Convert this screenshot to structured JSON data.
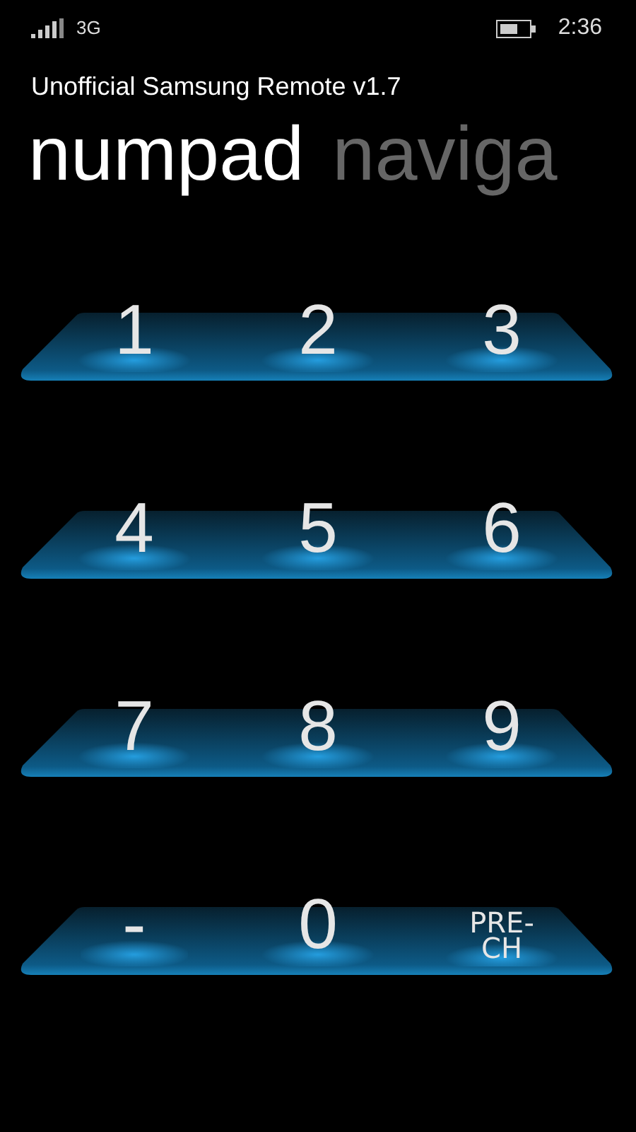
{
  "status_bar": {
    "network": "3G",
    "time": "2:36"
  },
  "app_title": "Unofficial Samsung Remote v1.7",
  "pivot": [
    {
      "label": "numpad",
      "selected": true
    },
    {
      "label": "naviga",
      "selected": false
    }
  ],
  "keypad_rows": [
    {
      "keys": [
        {
          "label": "1",
          "kind": "digit"
        },
        {
          "label": "2",
          "kind": "digit"
        },
        {
          "label": "3",
          "kind": "digit"
        }
      ]
    },
    {
      "keys": [
        {
          "label": "4",
          "kind": "digit"
        },
        {
          "label": "5",
          "kind": "digit"
        },
        {
          "label": "6",
          "kind": "digit"
        }
      ]
    },
    {
      "keys": [
        {
          "label": "7",
          "kind": "digit"
        },
        {
          "label": "8",
          "kind": "digit"
        },
        {
          "label": "9",
          "kind": "digit"
        }
      ]
    },
    {
      "keys": [
        {
          "label": "-",
          "kind": "digit"
        },
        {
          "label": "0",
          "kind": "digit"
        },
        {
          "label": "PRE-CH",
          "kind": "word"
        }
      ]
    }
  ]
}
